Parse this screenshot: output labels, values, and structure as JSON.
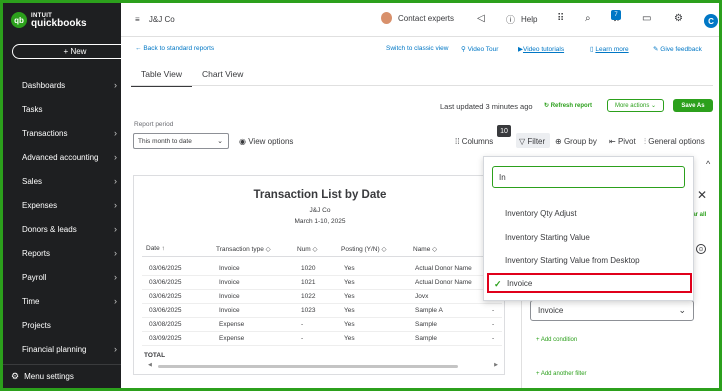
{
  "sidebar": {
    "logo_top": "INTUIT",
    "logo_bottom": "quickbooks",
    "logo_glyph": "qb",
    "new_button": "+ New",
    "items": [
      {
        "label": "Dashboards",
        "has_chevron": true
      },
      {
        "label": "Tasks",
        "has_chevron": false
      },
      {
        "label": "Transactions",
        "has_chevron": true
      },
      {
        "label": "Advanced accounting",
        "has_chevron": true
      },
      {
        "label": "Sales",
        "has_chevron": true
      },
      {
        "label": "Expenses",
        "has_chevron": true
      },
      {
        "label": "Donors & leads",
        "has_chevron": true
      },
      {
        "label": "Reports",
        "has_chevron": true
      },
      {
        "label": "Payroll",
        "has_chevron": true
      },
      {
        "label": "Time",
        "has_chevron": true
      },
      {
        "label": "Projects",
        "has_chevron": false
      },
      {
        "label": "Financial planning",
        "has_chevron": true
      }
    ],
    "menu_settings": "Menu settings"
  },
  "topbar": {
    "company": "J&J Co",
    "contact": "Contact experts",
    "help": "Help",
    "notifications_badge": "7",
    "user_initial": "C"
  },
  "report_header": {
    "back_link": "Back to standard reports",
    "switch_classic": "Switch to classic view",
    "video_tour": "Video Tour",
    "video_tutorials": "Video tutorials",
    "learn_more": "Learn more",
    "give_feedback": "Give feedback",
    "tabs": [
      "Table View",
      "Chart View"
    ],
    "last_updated": "Last updated 3 minutes ago",
    "refresh": "Refresh report",
    "more_actions": "More actions",
    "save_as": "Save As",
    "period_label": "Report period",
    "period_value": "This month to date",
    "view_options": "View options",
    "columns": "Columns",
    "columns_badge": "10",
    "filter": "Filter",
    "group_by": "Group by",
    "pivot": "Pivot",
    "general_options": "General options"
  },
  "report": {
    "title": "Transaction List by Date",
    "company": "J&J Co",
    "date_range": "March 1-10, 2025",
    "columns": [
      "Date ↑",
      "Transaction type ◇",
      "Num ◇",
      "Posting (Y/N) ◇",
      "Name ◇"
    ],
    "rows": [
      {
        "date": "03/06/2025",
        "type": "Invoice",
        "num": "1020",
        "posting": "Yes",
        "name": "Actual Donor Name",
        "extra": "-"
      },
      {
        "date": "03/06/2025",
        "type": "Invoice",
        "num": "1021",
        "posting": "Yes",
        "name": "Actual Donor Name",
        "extra": "-"
      },
      {
        "date": "03/06/2025",
        "type": "Invoice",
        "num": "1022",
        "posting": "Yes",
        "name": "Jovx",
        "extra": "-"
      },
      {
        "date": "03/06/2025",
        "type": "Invoice",
        "num": "1023",
        "posting": "Yes",
        "name": "Sample A",
        "extra": "-"
      },
      {
        "date": "03/08/2025",
        "type": "Expense",
        "num": "-",
        "posting": "Yes",
        "name": "Sample",
        "extra": "-"
      },
      {
        "date": "03/09/2025",
        "type": "Expense",
        "num": "-",
        "posting": "Yes",
        "name": "Sample",
        "extra": "-"
      }
    ],
    "total_label": "TOTAL"
  },
  "filter_panel": {
    "clear_all": "ear all",
    "selected_type": "Invoice",
    "add_condition": "+ Add condition",
    "add_filter": "+ Add another filter"
  },
  "dropdown": {
    "search_value": "In",
    "options": [
      {
        "label": "Inventory Qty Adjust",
        "selected": false
      },
      {
        "label": "Inventory Starting Value",
        "selected": false
      },
      {
        "label": "Inventory Starting Value from Desktop",
        "selected": false
      },
      {
        "label": "Invoice",
        "selected": true
      }
    ]
  },
  "colors": {
    "brand_green": "#2ca01c",
    "sidebar_bg": "#1e1f21",
    "link_blue": "#0077c5",
    "highlight_red": "#e0001b"
  }
}
